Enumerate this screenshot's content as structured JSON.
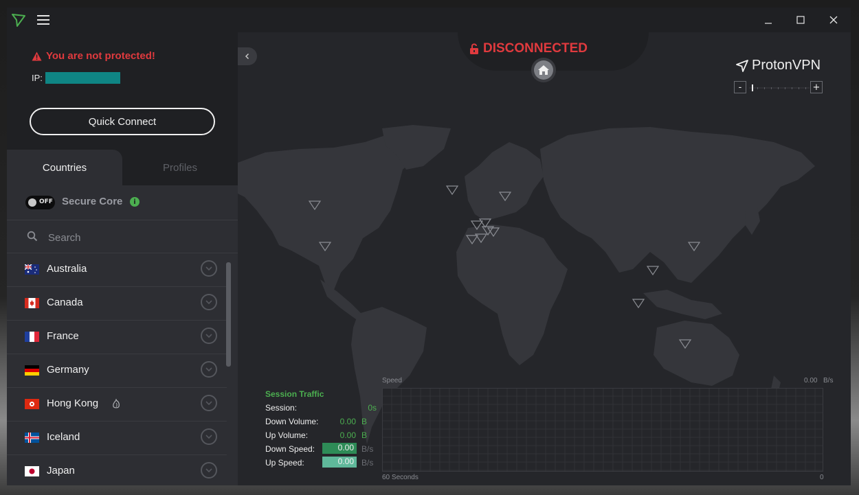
{
  "app": {
    "name": "ProtonVPN"
  },
  "header": {
    "warning": "You are not protected!",
    "ip_label": "IP:",
    "ip_value": "",
    "quick_connect": "Quick Connect"
  },
  "tabs": [
    {
      "label": "Countries",
      "active": true
    },
    {
      "label": "Profiles",
      "active": false
    }
  ],
  "secure_core": {
    "label": "Secure Core",
    "toggle_text": "OFF",
    "enabled": false
  },
  "search": {
    "placeholder": "Search",
    "value": ""
  },
  "countries": [
    {
      "name": "Australia",
      "flag": "au"
    },
    {
      "name": "Canada",
      "flag": "ca"
    },
    {
      "name": "France",
      "flag": "fr"
    },
    {
      "name": "Germany",
      "flag": "de"
    },
    {
      "name": "Hong Kong",
      "flag": "hk",
      "tor": true
    },
    {
      "name": "Iceland",
      "flag": "is"
    },
    {
      "name": "Japan",
      "flag": "jp"
    }
  ],
  "status": {
    "text": "DISCONNECTED",
    "color": "#e03a3e"
  },
  "map": {
    "brand": "ProtonVPN",
    "zoom_minus": "-",
    "zoom_plus": "+"
  },
  "session": {
    "title": "Session Traffic",
    "rows": {
      "session": {
        "label": "Session:",
        "value": "0s"
      },
      "down_volume": {
        "label": "Down Volume:",
        "value": "0.00",
        "unit": "B"
      },
      "up_volume": {
        "label": "Up Volume:",
        "value": "0.00",
        "unit": "B"
      },
      "down_speed": {
        "label": "Down Speed:",
        "value": "0.00",
        "unit": "B/s"
      },
      "up_speed": {
        "label": "Up Speed:",
        "value": "0.00",
        "unit": "B/s"
      }
    }
  },
  "speed_graph": {
    "title": "Speed",
    "max_value": "0.00",
    "max_unit": "B/s",
    "x_left": "60 Seconds",
    "x_right": "0"
  },
  "colors": {
    "accent": "#4caf50",
    "danger": "#e03a3e",
    "sidebar": "#1f2023",
    "panel": "#2d2e33"
  }
}
